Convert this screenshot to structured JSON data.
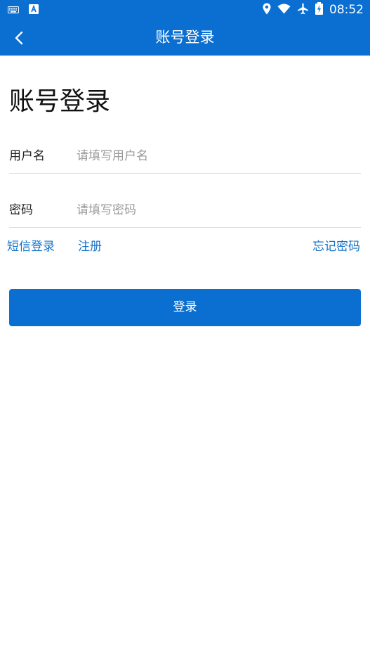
{
  "status_bar": {
    "time": "08:52",
    "left_icons": [
      "keyboard-icon",
      "a-notification-icon"
    ],
    "right_icons": [
      "location-icon",
      "wifi-icon",
      "airplane-icon",
      "battery-icon"
    ]
  },
  "app_bar": {
    "title": "账号登录",
    "back_icon": "chevron-left-icon"
  },
  "heading": "账号登录",
  "form": {
    "username": {
      "label": "用户名",
      "placeholder": "请填写用户名",
      "value": ""
    },
    "password": {
      "label": "密码",
      "placeholder": "请填写密码",
      "value": ""
    }
  },
  "links": {
    "sms_login": "短信登录",
    "register": "注册",
    "forgot_password": "忘记密码"
  },
  "login_button": "登录",
  "colors": {
    "primary": "#0A6FD1",
    "link": "#1673C9",
    "divider": "#dcdcdc",
    "placeholder": "#9a9a9a"
  }
}
